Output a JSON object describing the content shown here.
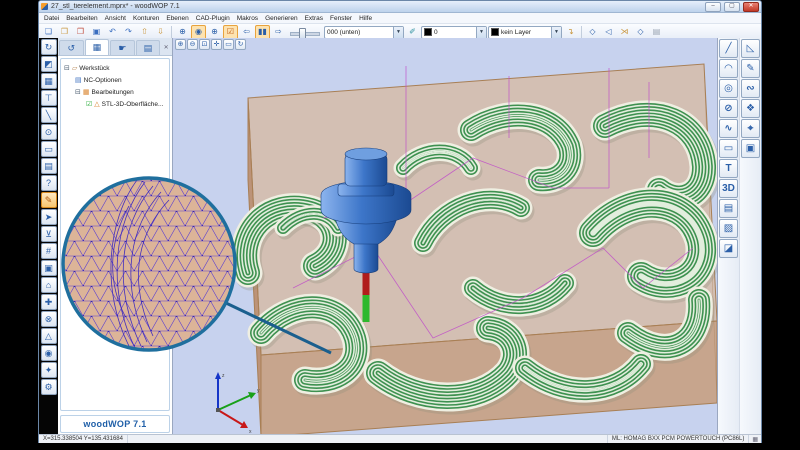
{
  "window": {
    "title": "27_stl_tierelement.mprx* - woodWOP 7.1",
    "controls": {
      "minimize": "–",
      "maximize": "▢",
      "close": "✕"
    }
  },
  "menu": {
    "items": [
      "Datei",
      "Bearbeiten",
      "Ansicht",
      "Konturen",
      "Ebenen",
      "CAD-Plugin",
      "Makros",
      "Generieren",
      "Extras",
      "Fenster",
      "Hilfe"
    ]
  },
  "toolbar": {
    "file_icons": [
      {
        "name": "new-file-icon",
        "glyph": "❏",
        "color": "#3a6ec0"
      },
      {
        "name": "open-file-icon",
        "glyph": "❒",
        "color": "#c9973f"
      },
      {
        "name": "new-template-icon",
        "glyph": "❐",
        "color": "#c04a3a"
      },
      {
        "name": "save-icon",
        "glyph": "▣",
        "color": "#3a6ec0"
      },
      {
        "name": "undo-icon",
        "glyph": "↶",
        "color": "#3a6ec0"
      },
      {
        "name": "redo-icon",
        "glyph": "↷",
        "color": "#3a6ec0"
      },
      {
        "name": "sheet-up-icon",
        "glyph": "⇧",
        "color": "#c9973f"
      },
      {
        "name": "sheet-down-icon",
        "glyph": "⇩",
        "color": "#c9973f"
      }
    ],
    "view_icons": [
      {
        "name": "zoom-all-icon",
        "glyph": "⊕",
        "color": "#2b5fa8"
      },
      {
        "name": "view-3d-icon",
        "glyph": "◉",
        "color": "#2b5fa8",
        "active": true
      },
      {
        "name": "zoom-window-icon",
        "glyph": "⊕",
        "color": "#2b5fa8"
      },
      {
        "name": "edit-check-icon",
        "glyph": "☑",
        "color": "#c05a10",
        "active": true
      }
    ],
    "nav_icons": [
      {
        "name": "step-back-icon",
        "glyph": "⇦",
        "color": "#2b5fa8"
      },
      {
        "name": "pause-simulation-icon",
        "glyph": "▮▮",
        "color": "#2b5fa8",
        "active": true
      },
      {
        "name": "step-forward-icon",
        "glyph": "⇨",
        "color": "#2b5fa8"
      }
    ],
    "combos": [
      {
        "name": "plane-combo",
        "value": "000 (unten)"
      },
      {
        "name": "color-combo",
        "value": "0"
      },
      {
        "name": "layer-combo",
        "value": "kein Layer"
      }
    ],
    "paint_glyph": "✐",
    "apply_glyph": "↴",
    "outline_icons": [
      {
        "name": "contour-diamond-icon",
        "glyph": "◇",
        "color": "#2b5fa8"
      },
      {
        "name": "contour-edit-icon",
        "glyph": "◁",
        "color": "#2b5fa8"
      },
      {
        "name": "contour-trim-icon",
        "glyph": "⋊",
        "color": "#c9973f"
      },
      {
        "name": "contour-offset-icon",
        "glyph": "◇",
        "color": "#2b5fa8"
      },
      {
        "name": "contour-disabled-icon",
        "glyph": "▤",
        "color": "#9aa4b2"
      }
    ],
    "combo_arrow": "▼"
  },
  "mini_toolbar": {
    "icons": [
      {
        "name": "zoom-in-icon",
        "glyph": "⊕"
      },
      {
        "name": "zoom-out-icon",
        "glyph": "⊖"
      },
      {
        "name": "zoom-fit-icon",
        "glyph": "⊡"
      },
      {
        "name": "pan-icon",
        "glyph": "✛"
      },
      {
        "name": "zoom-rect-icon",
        "glyph": "▭"
      },
      {
        "name": "rotate-view-icon",
        "glyph": "↻"
      }
    ]
  },
  "left_strip": {
    "icons": [
      {
        "name": "rotate-macro-icon",
        "glyph": "↻"
      },
      {
        "name": "workpiece-side-icon",
        "glyph": "◩"
      },
      {
        "name": "mesh-macro-icon",
        "glyph": "▦"
      },
      {
        "name": "drill-vertical-icon",
        "glyph": "⊤"
      },
      {
        "name": "saw-cut-icon",
        "glyph": "╲"
      },
      {
        "name": "circular-saw-icon",
        "glyph": "⊙"
      },
      {
        "name": "pocket-macro-icon",
        "glyph": "▭"
      },
      {
        "name": "report-macro-icon",
        "glyph": "▤"
      },
      {
        "name": "help-query-icon",
        "glyph": "?"
      },
      {
        "name": "edit-macro-icon",
        "glyph": "✎",
        "active": true
      },
      {
        "name": "pointer-macro-icon",
        "glyph": "➤"
      },
      {
        "name": "drill-horizontal-icon",
        "glyph": "⊻"
      },
      {
        "name": "grid-macro-icon",
        "glyph": "#"
      },
      {
        "name": "block-macro-icon",
        "glyph": "▣"
      },
      {
        "name": "home-macro-icon",
        "glyph": "⌂"
      },
      {
        "name": "add-macro-icon",
        "glyph": "✚"
      },
      {
        "name": "remove-macro-icon",
        "glyph": "⊗"
      },
      {
        "name": "triangle-macro-icon",
        "glyph": "△"
      },
      {
        "name": "target-macro-icon",
        "glyph": "◉"
      },
      {
        "name": "spark-macro-icon",
        "glyph": "✦"
      },
      {
        "name": "settings-macro-icon",
        "glyph": "⚙"
      }
    ]
  },
  "panel": {
    "tabs": [
      {
        "name": "tab-transform",
        "glyph": "↺"
      },
      {
        "name": "tab-workpiece",
        "glyph": "▦",
        "active": true
      },
      {
        "name": "tab-pick",
        "glyph": "☛"
      },
      {
        "name": "tab-list",
        "glyph": "▤"
      }
    ],
    "close_glyph": "✕",
    "tree": {
      "expander_open": "⊟",
      "items": {
        "werkstueck": "Werkstück",
        "nc_optionen": "NC-Optionen",
        "bearbeitungen": "Bearbeitungen",
        "stl": "STL-3D-Oberfläche..."
      },
      "check_glyph": "☑",
      "stl_glyph": "△",
      "box_glyph": "▱",
      "doc_glyph": "▤",
      "gear_glyph": "▦"
    },
    "brand": "woodWOP 7.1"
  },
  "right_toolbar": {
    "col1": [
      {
        "name": "line-tool-icon",
        "glyph": "╱"
      },
      {
        "name": "arc-tool-icon",
        "glyph": "◠"
      },
      {
        "name": "circle-tool-icon",
        "glyph": "◎"
      },
      {
        "name": "ellipse-tool-icon",
        "glyph": "⊘"
      },
      {
        "name": "spline-tool-icon",
        "glyph": "∿"
      },
      {
        "name": "rectangle-tool-icon",
        "glyph": "▭"
      },
      {
        "name": "text-tool-icon",
        "glyph": "T"
      },
      {
        "name": "dimension-3d-icon",
        "glyph": "3D"
      },
      {
        "name": "surface-tool-icon",
        "glyph": "▤"
      },
      {
        "name": "mesh-surface-icon",
        "glyph": "▨"
      },
      {
        "name": "sweep-surface-icon",
        "glyph": "◪"
      }
    ],
    "col2": [
      {
        "name": "select-vertex-icon",
        "glyph": "◺"
      },
      {
        "name": "edit-point-icon",
        "glyph": "✎"
      },
      {
        "name": "curve-smooth-icon",
        "glyph": "∾"
      },
      {
        "name": "explode-icon",
        "glyph": "❖"
      },
      {
        "name": "snap-icon",
        "glyph": "⌖"
      },
      {
        "name": "solid-box-icon",
        "glyph": "▣"
      }
    ]
  },
  "viewport": {
    "axis_labels": {
      "x": "x",
      "y": "y",
      "z": "z"
    }
  },
  "statusbar": {
    "coords": "X=315.338504 Y=135.431684",
    "machine": "ML: HOMAG BXX PCM POWERTOUCH (PC86L)",
    "printer_glyph": "▦"
  },
  "colors": {
    "accent": "#2b5fa8",
    "highlight_orange": "#e8a33d",
    "tool_blue": "#2e6bc4",
    "toolpath_green": "#3e9150",
    "rapid_magenta": "#c050c8",
    "wood_tan": "#d9a77c",
    "viewport_bg": "#c7d2ee",
    "mesh_blue": "#4433cc"
  }
}
